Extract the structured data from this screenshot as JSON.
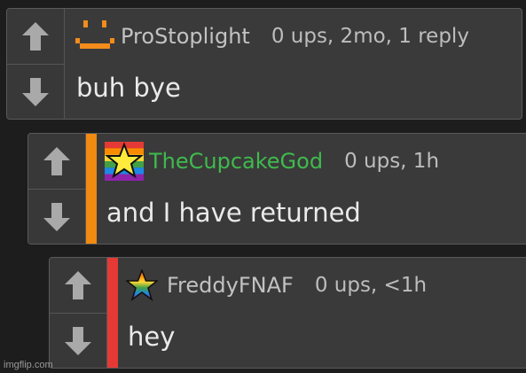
{
  "comments": [
    {
      "username": "ProStoplight",
      "meta": "0 ups, 2mo, 1 reply",
      "text": "buh bye",
      "avatar_icon": "orange-smiley-icon",
      "bar_color": null
    },
    {
      "username": "TheCupcakeGod",
      "meta": "0 ups, 1h",
      "text": "and I have returned",
      "avatar_icon": "rainbow-flag-star-icon",
      "username_color": "#3fba4d",
      "bar_color": "#f08a10"
    },
    {
      "username": "FreddyFNAF",
      "meta": "0 ups, <1h",
      "text": "hey",
      "avatar_icon": "rainbow-star-icon",
      "bar_color": "#e53935"
    }
  ],
  "watermark": "imgflip.com",
  "vote_icons": {
    "up": "arrow-up-icon",
    "down": "arrow-down-icon"
  }
}
